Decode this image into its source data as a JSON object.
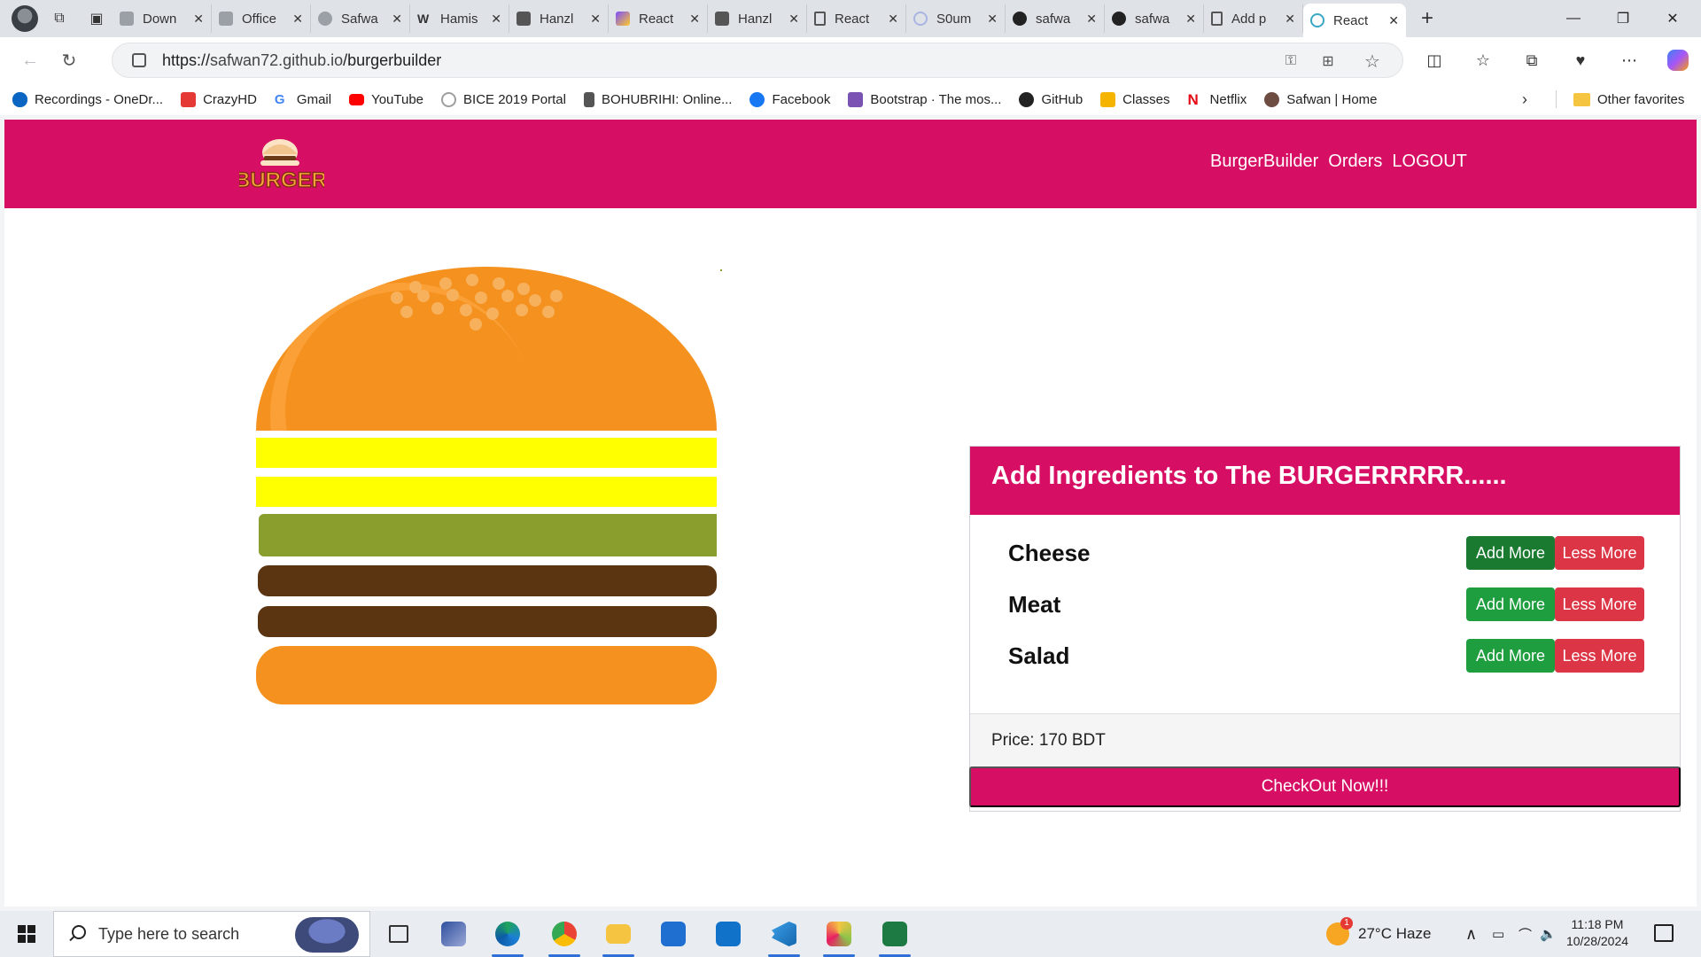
{
  "browser": {
    "tabs": [
      {
        "title": "Down",
        "icon": "gear-icon"
      },
      {
        "title": "Office",
        "icon": "page-icon"
      },
      {
        "title": "Safwa",
        "icon": "avatar-icon"
      },
      {
        "title": "Hamis",
        "icon": "wikipedia-icon"
      },
      {
        "title": "Hanzl",
        "icon": "code-icon"
      },
      {
        "title": "React",
        "icon": "vite-icon"
      },
      {
        "title": "Hanzl",
        "icon": "code-icon"
      },
      {
        "title": "React",
        "icon": "page-icon"
      },
      {
        "title": "S0um",
        "icon": "spinner-icon"
      },
      {
        "title": "safwa",
        "icon": "github-icon"
      },
      {
        "title": "safwa",
        "icon": "github-icon"
      },
      {
        "title": "Add p",
        "icon": "page-icon"
      },
      {
        "title": "React",
        "icon": "react-icon",
        "active": true
      }
    ],
    "url_prefix": "https://",
    "url_host": "safwan72.github.io",
    "url_path": "/burgerbuilder",
    "bookmarks": [
      {
        "label": "Recordings - OneDr...",
        "color": "#0a66c2"
      },
      {
        "label": "CrazyHD",
        "color": "#e53935"
      },
      {
        "label": "Gmail",
        "color": "#4285f4"
      },
      {
        "label": "YouTube",
        "color": "#ff0000"
      },
      {
        "label": "BICE 2019 Portal",
        "color": "#9e9e9e"
      },
      {
        "label": "BOHUBRIHI: Online...",
        "color": "#555555"
      },
      {
        "label": "Facebook",
        "color": "#1877f2"
      },
      {
        "label": "Bootstrap · The mos...",
        "color": "#7952b3"
      },
      {
        "label": "GitHub",
        "color": "#222222"
      },
      {
        "label": "Classes",
        "color": "#f4b400"
      },
      {
        "label": "Netflix",
        "color": "#e50914"
      },
      {
        "label": "Safwan | Home",
        "color": "#6d4c41"
      }
    ],
    "other_favorites": "Other favorites"
  },
  "app": {
    "logo_text": "BURGER",
    "nav": {
      "builder": "BurgerBuilder",
      "orders": "Orders",
      "logout": "LOGOUT"
    },
    "burger_layers": [
      "cheese",
      "cheese",
      "salad",
      "meat",
      "meat"
    ],
    "controls": {
      "title": "Add Ingredients to The BURGERRRRR......",
      "ingredients": [
        {
          "label": "Cheese",
          "add": "Add More",
          "less": "Less More"
        },
        {
          "label": "Meat",
          "add": "Add More",
          "less": "Less More"
        },
        {
          "label": "Salad",
          "add": "Add More",
          "less": "Less More"
        }
      ],
      "price": "Price: 170 BDT",
      "checkout": "CheckOut Now!!!"
    },
    "colors": {
      "brand": "#d70f64",
      "add_button": "#1e9e3e",
      "less_button": "#dc3545",
      "bun": "#f5911e",
      "cheese": "#ffff00",
      "salad": "#8a9e2d",
      "meat": "#5b3512"
    }
  },
  "taskbar": {
    "search_placeholder": "Type here to search",
    "weather": "27°C  Haze",
    "weather_badge": "1",
    "time": "11:18 PM",
    "date": "10/28/2024",
    "apps": [
      "task-view-icon",
      "snip-icon",
      "edge-icon",
      "chrome-icon",
      "file-explorer-icon",
      "store-icon",
      "outlook-icon",
      "vscode-icon",
      "paint-icon",
      "excel-icon"
    ]
  }
}
